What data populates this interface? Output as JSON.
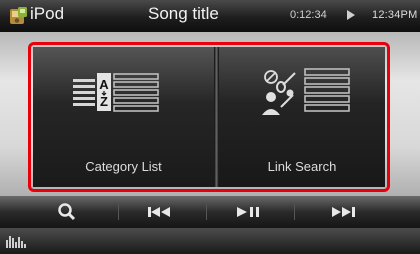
{
  "header": {
    "source": "iPod",
    "title": "Song title",
    "elapsed": "0:12:34",
    "clock": "12:34PM"
  },
  "menu": {
    "items": [
      {
        "label": "Category List",
        "icon": "category-list-icon"
      },
      {
        "label": "Link Search",
        "icon": "link-search-icon"
      }
    ]
  },
  "controls": {
    "buttons": [
      "search-icon",
      "previous-track-icon",
      "play-pause-icon",
      "next-track-icon"
    ]
  },
  "bottom": {
    "icon": "equalizer-icon"
  },
  "colors": {
    "highlight": "#e8000b",
    "header": "#1e1e1e",
    "text": "#dcdcdc"
  }
}
